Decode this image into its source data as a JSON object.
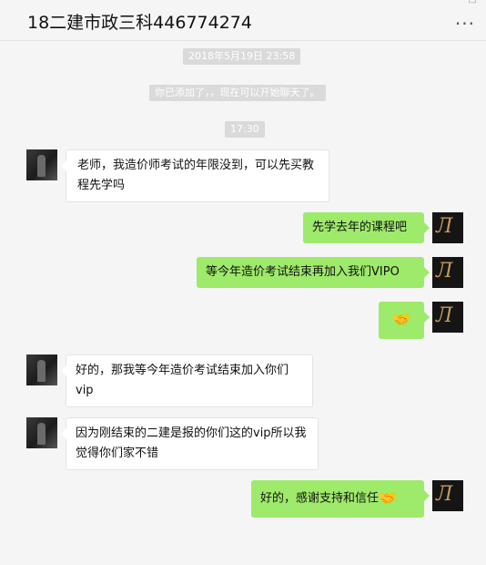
{
  "window": {
    "title": "18二建市政三科446774274",
    "more_label": "...",
    "controls": [
      "—",
      "□"
    ]
  },
  "timestamps": {
    "first": "2018年5月19日 23:58",
    "second": "17:30"
  },
  "system_notice": "你已添加了，，现在可以开始聊天了。",
  "messages": [
    {
      "side": "left",
      "text": "老师，我造价师考试的年限没到，可以先买教程先学吗"
    },
    {
      "side": "right",
      "text": "先学去年的课程吧"
    },
    {
      "side": "right",
      "text": "等今年造价考试结束再加入我们VIPO"
    },
    {
      "side": "right",
      "text": "🤝"
    },
    {
      "side": "left",
      "text": "好的，那我等今年造价考试结束加入你们vip"
    },
    {
      "side": "left",
      "text": "因为刚结束的二建是报的你们这的vip所以我觉得你们家不错"
    },
    {
      "side": "right",
      "text": "好的，感谢支持和信任",
      "emoji": "🤝"
    }
  ],
  "icons": {
    "handshake": "handshake-emoji",
    "more": "more-icon",
    "avatar_left": "user-avatar",
    "avatar_right": "teacher-avatar"
  }
}
